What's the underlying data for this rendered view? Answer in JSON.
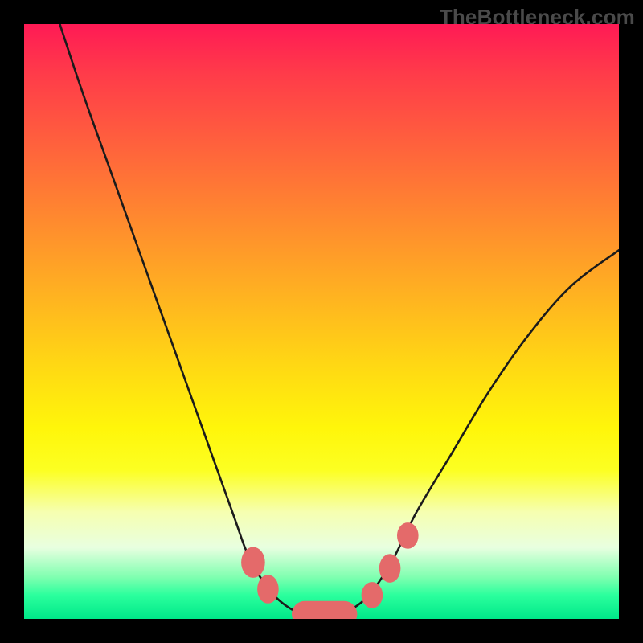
{
  "watermark": "TheBottleneck.com",
  "chart_data": {
    "type": "line",
    "title": "",
    "xlabel": "",
    "ylabel": "",
    "xlim": [
      0,
      100
    ],
    "ylim": [
      0,
      100
    ],
    "series": [
      {
        "name": "bottleneck-curve",
        "x": [
          6,
          10,
          15,
          20,
          25,
          30,
          35,
          38,
          42,
          46,
          49,
          51,
          54,
          58,
          62,
          66,
          72,
          78,
          85,
          92,
          100
        ],
        "y": [
          100,
          88,
          74,
          60,
          46,
          32,
          18,
          10,
          4,
          1,
          0,
          0,
          1,
          4,
          10,
          18,
          28,
          38,
          48,
          56,
          62
        ]
      }
    ],
    "markers": [
      {
        "shape": "ellipse",
        "x": 38.5,
        "y": 9.5,
        "rx": 2.0,
        "ry": 2.6
      },
      {
        "shape": "ellipse",
        "x": 41.0,
        "y": 5.0,
        "rx": 1.8,
        "ry": 2.4
      },
      {
        "shape": "pill",
        "x0": 45.0,
        "x1": 56.0,
        "y": 0.8,
        "r": 2.2
      },
      {
        "shape": "ellipse",
        "x": 58.5,
        "y": 4.0,
        "rx": 1.8,
        "ry": 2.2
      },
      {
        "shape": "ellipse",
        "x": 61.5,
        "y": 8.5,
        "rx": 1.8,
        "ry": 2.4
      },
      {
        "shape": "ellipse",
        "x": 64.5,
        "y": 14.0,
        "rx": 1.8,
        "ry": 2.2
      }
    ],
    "gradient_stops": [
      {
        "pos": 0,
        "color": "#ff1a55"
      },
      {
        "pos": 50,
        "color": "#ffda13"
      },
      {
        "pos": 88,
        "color": "#e8ffe0"
      },
      {
        "pos": 100,
        "color": "#00e889"
      }
    ]
  }
}
